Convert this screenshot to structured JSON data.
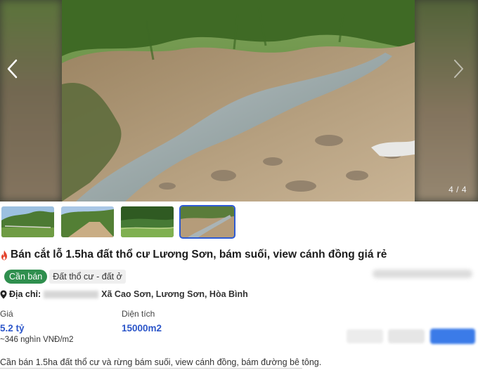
{
  "gallery": {
    "counter": "4 / 4",
    "prev_icon": "chevron-left-icon",
    "next_icon": "chevron-right-icon"
  },
  "thumbnails": [
    {
      "name": "thumbnail-1",
      "active": false
    },
    {
      "name": "thumbnail-2",
      "active": false
    },
    {
      "name": "thumbnail-3",
      "active": false
    },
    {
      "name": "thumbnail-4",
      "active": true
    }
  ],
  "listing": {
    "title": "Bán cắt lỗ 1.5ha đất thổ cư Lương Sơn, bám suối, view cánh đồng giá rẻ",
    "title_icon": "flame-icon",
    "tags": [
      "Cần bán",
      "Đất thổ cư - đất ở"
    ],
    "address_label": "Địa chỉ:",
    "address_visible": "Xã Cao Sơn, Lương Sơn, Hòa Bình",
    "price_label": "Giá",
    "price_value": "5.2 tỷ",
    "price_per_unit": "~346 nghìn VNĐ/m2",
    "area_label": "Diện tích",
    "area_value": "15000m2",
    "description": "Cần bán 1.5ha đất thổ cư và rừng bám suối, view cánh đồng, bám đường bê tông."
  },
  "colors": {
    "accent_blue": "#2c56c9",
    "tag_green": "#2f8f4e",
    "flame_red": "#e4432d"
  }
}
